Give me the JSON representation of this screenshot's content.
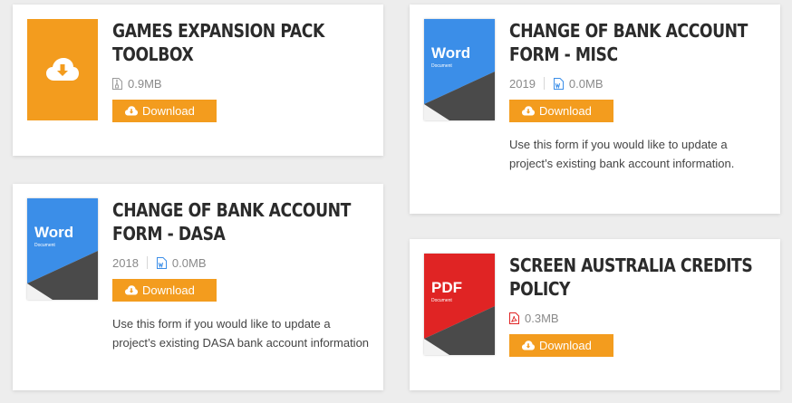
{
  "colors": {
    "accent": "#f39c1e",
    "word_blue": "#3b8ee8",
    "pdf_red": "#e02424",
    "dark_band": "#4a4a4a"
  },
  "cards": [
    {
      "title": "GAMES EXPANSION PACK TOOLBOX",
      "thumb": "download-cloud-icon",
      "size": "0.9MB",
      "download_label": "Download"
    },
    {
      "title": "CHANGE OF BANK ACCOUNT FORM - DASA",
      "thumb": "word-document",
      "thumb_label": "Word",
      "thumb_sublabel": "Document",
      "year": "2018",
      "size": "0.0MB",
      "download_label": "Download",
      "description": "Use this form if you would like to update a project’s existing DASA bank account information"
    },
    {
      "title": "CHANGE OF BANK ACCOUNT FORM - MISC",
      "thumb": "word-document",
      "thumb_label": "Word",
      "thumb_sublabel": "Document",
      "year": "2019",
      "size": "0.0MB",
      "download_label": "Download",
      "description": "Use this form if you would like to update a project’s existing bank account information."
    },
    {
      "title": "SCREEN AUSTRALIA CREDITS POLICY",
      "thumb": "pdf-document",
      "thumb_label": "PDF",
      "thumb_sublabel": "Document",
      "size": "0.3MB",
      "download_label": "Download"
    }
  ]
}
